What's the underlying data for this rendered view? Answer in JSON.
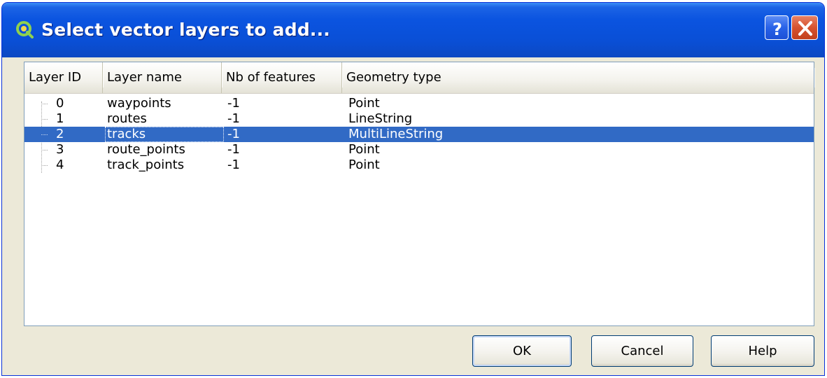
{
  "window": {
    "title": "Select vector layers to add...",
    "app_icon": "qgis-icon",
    "help_icon": "question-icon",
    "close_icon": "close-icon"
  },
  "table": {
    "columns": [
      "Layer ID",
      "Layer name",
      "Nb of features",
      "Geometry type"
    ],
    "rows": [
      {
        "id": "0",
        "name": "waypoints",
        "features": "-1",
        "geometry": "Point",
        "selected": false
      },
      {
        "id": "1",
        "name": "routes",
        "features": "-1",
        "geometry": "LineString",
        "selected": false
      },
      {
        "id": "2",
        "name": "tracks",
        "features": "-1",
        "geometry": "MultiLineString",
        "selected": true
      },
      {
        "id": "3",
        "name": "route_points",
        "features": "-1",
        "geometry": "Point",
        "selected": false
      },
      {
        "id": "4",
        "name": "track_points",
        "features": "-1",
        "geometry": "Point",
        "selected": false
      }
    ]
  },
  "buttons": {
    "ok": "OK",
    "cancel": "Cancel",
    "help": "Help"
  },
  "colors": {
    "title_bar": "#0a4fd6",
    "selection": "#316ac5",
    "dialog_bg": "#ece9d8"
  }
}
